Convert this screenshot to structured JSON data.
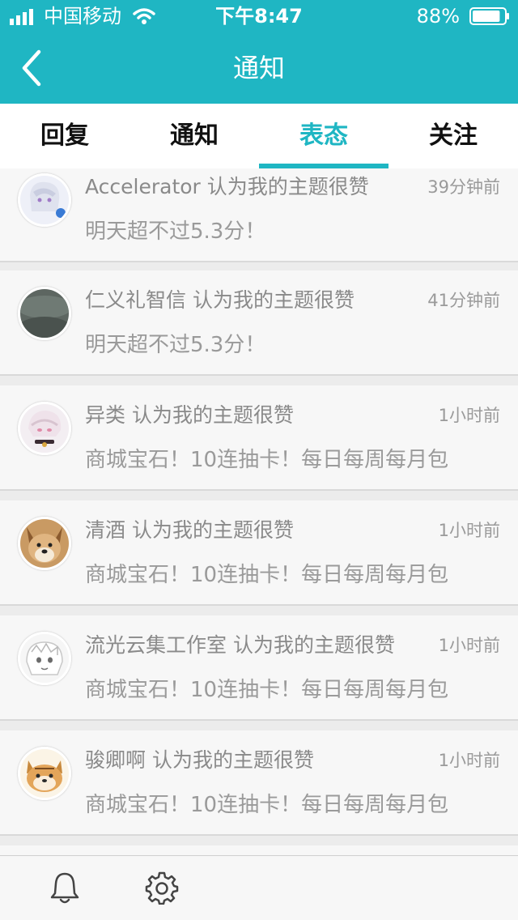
{
  "status_bar": {
    "carrier": "中国移动",
    "time": "下午8:47",
    "battery": "88%",
    "battery_level": 0.88,
    "icons": [
      "signal-icon",
      "wifi-icon",
      "battery-icon"
    ]
  },
  "header": {
    "title": "通知",
    "back_icon": "chevron-left-icon"
  },
  "tabs": [
    {
      "label": "回复",
      "active": false
    },
    {
      "label": "通知",
      "active": false
    },
    {
      "label": "表态",
      "active": true
    },
    {
      "label": "关注",
      "active": false
    }
  ],
  "notifications": [
    {
      "title": "Accelerator 认为我的主题很赞",
      "time": "39分钟前",
      "content": "明天超不过5.3分！"
    },
    {
      "title": "仁义礼智信 认为我的主题很赞",
      "time": "41分钟前",
      "content": "明天超不过5.3分！"
    },
    {
      "title": "异类 认为我的主题很赞",
      "time": "1小时前",
      "content": "商城宝石！10连抽卡！每日每周每月包"
    },
    {
      "title": "清酒 认为我的主题很赞",
      "time": "1小时前",
      "content": "商城宝石！10连抽卡！每日每周每月包"
    },
    {
      "title": "流光云集工作室 认为我的主题很赞",
      "time": "1小时前",
      "content": "商城宝石！10连抽卡！每日每周每月包"
    },
    {
      "title": "骏卿啊 认为我的主题很赞",
      "time": "1小时前",
      "content": "商城宝石！10连抽卡！每日每周每月包"
    }
  ],
  "bottom_bar": {
    "icons": [
      "bell-icon",
      "gear-icon"
    ]
  },
  "colors": {
    "accent": "#1fb6c3",
    "background": "#ececec",
    "card": "#f7f7f7"
  }
}
